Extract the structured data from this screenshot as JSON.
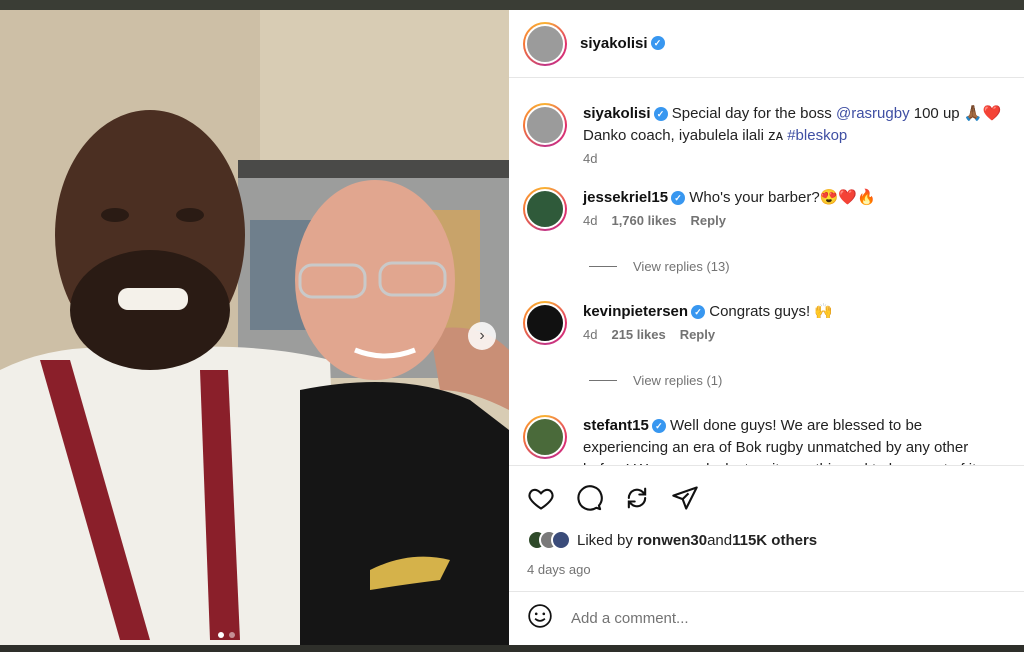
{
  "post": {
    "author": "siyakolisi",
    "caption_prefix": "Special day for the boss ",
    "caption_mention": "@rasrugby",
    "caption_middle": " 100 up 🙏🏾❤️ Danko coach, iyabulela ilali ᴢᴀ ",
    "caption_hashtag": "#bleskop",
    "caption_age": "4d"
  },
  "comments": [
    {
      "user": "jessekriel15",
      "text": "Who's your barber?😍❤️🔥",
      "age": "4d",
      "likes": "1,760 likes",
      "reply": "Reply",
      "view_replies": "View replies (13)"
    },
    {
      "user": "kevinpietersen",
      "text": "Congrats guys! 🙌",
      "age": "4d",
      "likes": "215 likes",
      "reply": "Reply",
      "view_replies": "View replies (1)"
    },
    {
      "user": "stefant15",
      "text": "Well done guys! We are blessed to be experiencing an era of Bok rugby unmatched by any other before! We are so lucky to witness this and to be a part of it.",
      "age": "4d"
    }
  ],
  "likes": {
    "prefix": "Liked by ",
    "user": "ronwen30",
    "mid": " and ",
    "count": "115K others"
  },
  "date": "4 days ago",
  "add_comment": {
    "placeholder": "Add a comment..."
  },
  "icons": [
    "heart-icon",
    "comment-icon",
    "repost-icon",
    "share-icon",
    "emoji-icon",
    "chevron-right-icon"
  ],
  "colors": {
    "verified": "#3897f0",
    "link": "#3f4fa3",
    "muted": "#737373"
  }
}
